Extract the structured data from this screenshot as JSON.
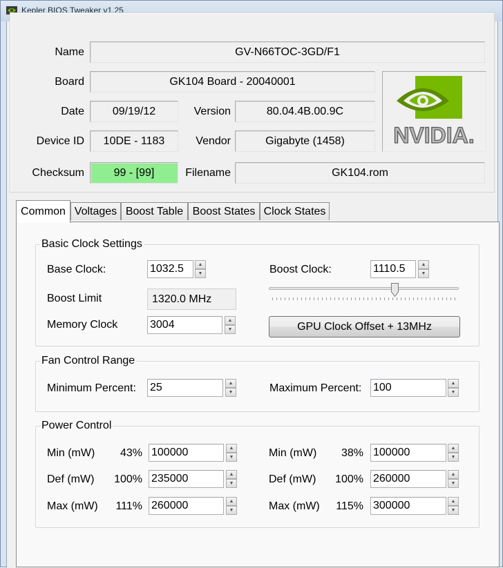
{
  "window": {
    "title": "Kepler BIOS Tweaker v1.25"
  },
  "info": {
    "name_label": "Name",
    "name_value": "GV-N66TOC-3GD/F1",
    "board_label": "Board",
    "board_value": "GK104 Board - 20040001",
    "date_label": "Date",
    "date_value": "09/19/12",
    "version_label": "Version",
    "version_value": "80.04.4B.00.9C",
    "device_label": "Device ID",
    "device_value": "10DE - 1183",
    "vendor_label": "Vendor",
    "vendor_value": "Gigabyte (1458)",
    "checksum_label": "Checksum",
    "checksum_value": "99 - [99]",
    "filename_label": "Filename",
    "filename_value": "GK104.rom",
    "logo_text": "NVIDIA."
  },
  "tabs": [
    "Common",
    "Voltages",
    "Boost Table",
    "Boost States",
    "Clock States"
  ],
  "clock": {
    "title": "Basic Clock Settings",
    "base_label": "Base Clock:",
    "base_value": "1032.5",
    "boost_label": "Boost Clock:",
    "boost_value": "1110.5",
    "boost_limit_label": "Boost Limit",
    "boost_limit_value": "1320.0 MHz",
    "memory_label": "Memory Clock",
    "memory_value": "3004",
    "offset_button": "GPU Clock Offset + 13MHz"
  },
  "fan": {
    "title": "Fan Control Range",
    "min_label": "Minimum Percent:",
    "min_value": "25",
    "max_label": "Maximum Percent:",
    "max_value": "100"
  },
  "power": {
    "title": "Power Control",
    "left": [
      {
        "label": "Min (mW)",
        "pct": "43%",
        "value": "100000"
      },
      {
        "label": "Def (mW)",
        "pct": "100%",
        "value": "235000"
      },
      {
        "label": "Max (mW)",
        "pct": "111%",
        "value": "260000"
      }
    ],
    "right": [
      {
        "label": "Min (mW)",
        "pct": "38%",
        "value": "100000"
      },
      {
        "label": "Def (mW)",
        "pct": "100%",
        "value": "260000"
      },
      {
        "label": "Max (mW)",
        "pct": "115%",
        "value": "300000"
      }
    ]
  },
  "colors": {
    "checksum_ok": "#90ee90",
    "nvidia_green": "#76b900"
  }
}
